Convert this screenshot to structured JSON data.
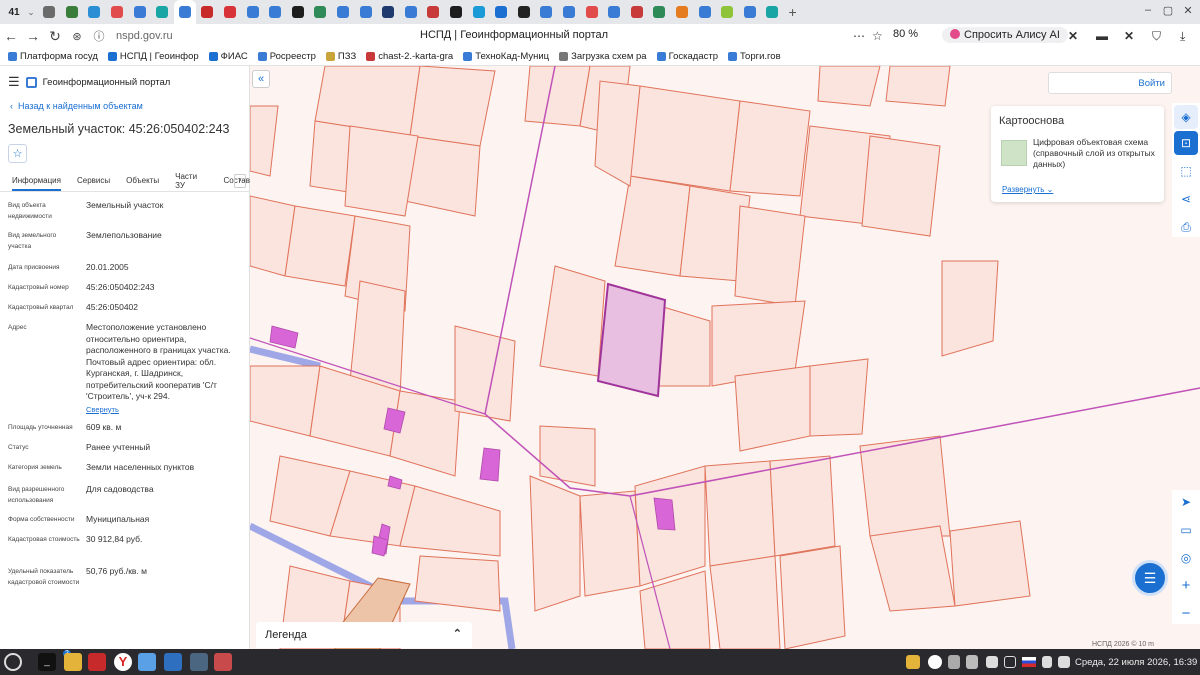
{
  "browser": {
    "tab_count": "41",
    "tab_colors": [
      "#6b6b6b",
      "#3a7d3a",
      "#2b8fd6",
      "#e24b4b",
      "#3a7bd5",
      "#1aa5a5",
      "#3a7bd5",
      "#c82a2a",
      "#d9333a",
      "#3a7bd5",
      "#3a7bd5",
      "#1d1d1d",
      "#2e8b57",
      "#3a7bd5",
      "#3a7bd5",
      "#1e3a6e",
      "#3a7bd5",
      "#c83a3a",
      "#1d1d1d",
      "#1a9ad6",
      "#1a6fd1",
      "#222",
      "#3a7bd5",
      "#3a7bd5",
      "#e24b4b",
      "#3a7bd5",
      "#c83a3a",
      "#2e8b57",
      "#e57c1f",
      "#3a7bd5",
      "#8fc43a",
      "#3a7bd5",
      "#1aa5a5"
    ],
    "url": "nspd.gov.ru",
    "page_title": "НСПД | Геоинформационный портал",
    "zoom": "80 %",
    "alice_label": "Спросить Алису AI",
    "bookmarks": [
      "Платформа госуд",
      "НСПД | Геоинфор",
      "ФИАС",
      "Росреестр",
      "ПЗЗ",
      "chast-2.-karta-gra",
      "ТехноКад-Муниц",
      "Загрузка схем ра",
      "Госкадастр",
      "Торги.гов"
    ],
    "bookmark_colors": [
      "#3a7bd5",
      "#1a6fd1",
      "#1a6fd1",
      "#3a7bd5",
      "#c8a43a",
      "#c83a3a",
      "#3a7bd5",
      "#777",
      "#3a7bd5",
      "#3a7bd5"
    ]
  },
  "panel": {
    "portal_title": "Геоинформационный портал",
    "back_link": "Назад к найденным объектам",
    "title": "Земельный участок: 45:26:050402:243",
    "tabs": [
      "Информация",
      "Сервисы",
      "Объекты",
      "Части ЗУ",
      "Состав"
    ],
    "rows": [
      {
        "label": "Вид объекта недвижимости",
        "value": "Земельный участок"
      },
      {
        "label": "Вид земельного участка",
        "value": "Землепользование"
      },
      {
        "label": "Дата присвоения",
        "value": "20.01.2005"
      },
      {
        "label": "Кадастровый номер",
        "value": "45:26:050402:243"
      },
      {
        "label": "Кадастровый квартал",
        "value": "45:26:050402"
      },
      {
        "label": "Адрес",
        "value": "Местоположение установлено относительно ориентира, расположенного в границах участка. Почтовый адрес ориентира: обл. Курганская, г. Шадринск, потребительский кооператив 'С/т 'Строитель', уч-к 294."
      },
      {
        "label": "Площадь уточненная",
        "value": "609 кв. м"
      },
      {
        "label": "Статус",
        "value": "Ранее учтенный"
      },
      {
        "label": "Категория земель",
        "value": "Земли населенных пунктов"
      },
      {
        "label": "Вид разрешенного использования",
        "value": "Для садоводства"
      },
      {
        "label": "Форма собственности",
        "value": "Муниципальная"
      },
      {
        "label": "Кадастровая стоимость",
        "value": "30 912,84 руб."
      },
      {
        "label": "Удельный показатель кадастровой стоимости",
        "value": "50,76 руб./кв. м"
      }
    ],
    "collapse_link": "Свернуть"
  },
  "map": {
    "login": "Войти",
    "basemap_title": "Картооснова",
    "basemap_desc": "Цифровая объектовая схема (справочный слой из открытых данных)",
    "basemap_expand": "Развернуть",
    "legend": "Легенда",
    "scale": "НСПД 2026 ©          10 m",
    "parcel_stroke": "#e0735a",
    "parcel_fill": "#fbe3de",
    "selected_fill": "#e8bfe0",
    "selected_stroke": "#a0349a",
    "building_fill": "#d966d6",
    "road_color": "#9fa7e6"
  },
  "taskbar": {
    "clock": "Среда, 22 июля 2026, 16:39",
    "badge": "2"
  }
}
